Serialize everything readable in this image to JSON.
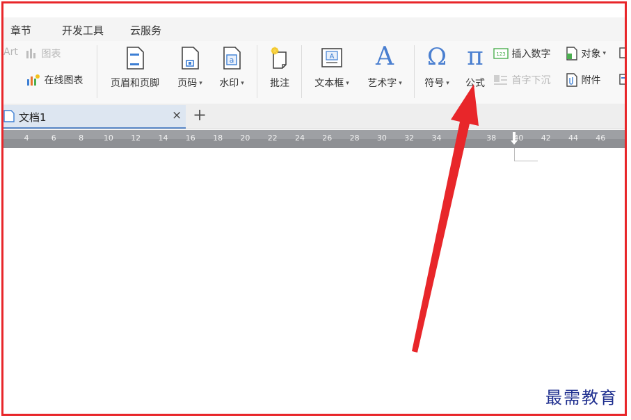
{
  "menu": {
    "items": [
      "章节",
      "开发工具",
      "云服务"
    ]
  },
  "ribbon": {
    "art_label": "Art",
    "chart_label": "图表",
    "online_chart_label": "在线图表",
    "header_footer_label": "页眉和页脚",
    "page_number_label": "页码",
    "watermark_label": "水印",
    "comment_label": "批注",
    "textbox_label": "文本框",
    "wordart_label": "艺术字",
    "symbol_label": "符号",
    "formula_label": "公式",
    "insert_number_label": "插入数字",
    "dropcap_label": "首字下沉",
    "object_label": "对象",
    "attachment_label": "附件"
  },
  "tabs": {
    "doc_title": "文档1",
    "close_glyph": "×",
    "new_glyph": "+"
  },
  "ruler": {
    "ticks": [
      "4",
      "6",
      "8",
      "10",
      "12",
      "14",
      "16",
      "18",
      "20",
      "22",
      "24",
      "26",
      "28",
      "30",
      "32",
      "34",
      "6",
      "38",
      "40",
      "42",
      "44",
      "46"
    ]
  },
  "watermark": {
    "text": "最需教育"
  },
  "colors": {
    "frame": "#e8262a",
    "accent_blue": "#4a7fd0",
    "arrow": "#e8262a"
  }
}
